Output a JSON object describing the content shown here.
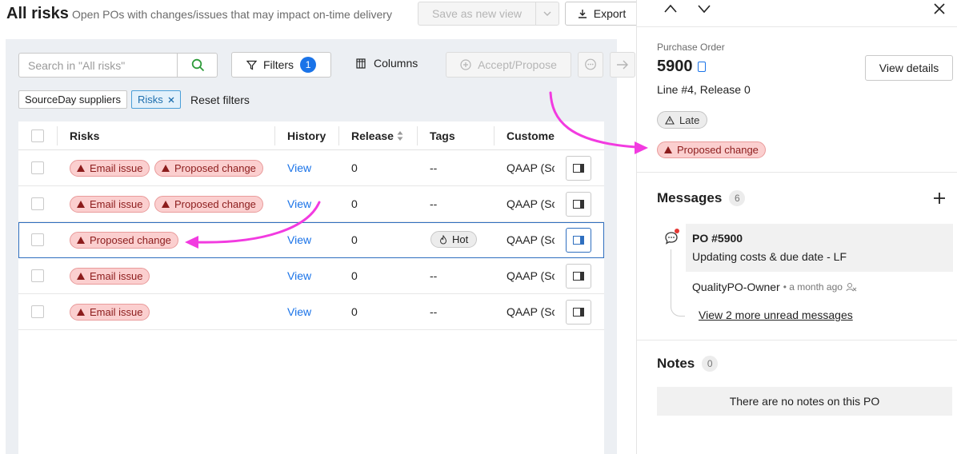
{
  "header": {
    "title": "All risks",
    "subtitle": "Open POs with changes/issues that may impact on-time delivery",
    "save_view_label": "Save as new view",
    "export_label": "Export"
  },
  "toolbar": {
    "search_placeholder": "Search in \"All risks\"",
    "filters_label": "Filters",
    "filters_count": "1",
    "columns_label": "Columns",
    "accept_label": "Accept/Propose"
  },
  "filter_chips": {
    "suppliers": "SourceDay suppliers",
    "risks": "Risks",
    "reset": "Reset filters"
  },
  "table": {
    "headers": [
      "Risks",
      "History",
      "Release",
      "Tags",
      "Custome"
    ],
    "rows": [
      {
        "risks": [
          "Email issue",
          "Proposed change"
        ],
        "history": "View",
        "release": "0",
        "tags": "--",
        "customer": "QAAP (Sc",
        "selected": false
      },
      {
        "risks": [
          "Email issue",
          "Proposed change"
        ],
        "history": "View",
        "release": "0",
        "tags": "--",
        "customer": "QAAP (Sc",
        "selected": false
      },
      {
        "risks": [
          "Proposed change"
        ],
        "history": "View",
        "release": "0",
        "tags": "Hot",
        "customer": "QAAP (Sc",
        "selected": true
      },
      {
        "risks": [
          "Email issue"
        ],
        "history": "View",
        "release": "0",
        "tags": "--",
        "customer": "QAAP (Sc",
        "selected": false
      },
      {
        "risks": [
          "Email issue"
        ],
        "history": "View",
        "release": "0",
        "tags": "--",
        "customer": "QAAP (Sc",
        "selected": false
      }
    ]
  },
  "detail": {
    "po_label": "Purchase Order",
    "po_number": "5900",
    "line_info": "Line #4, Release 0",
    "view_details_label": "View details",
    "late_label": "Late",
    "proposed_label": "Proposed change",
    "messages": {
      "title": "Messages",
      "count": "6",
      "thread_title": "PO #5900",
      "thread_text": "Updating costs & due date - LF",
      "author": "QualityPO-Owner",
      "time": "• a month ago",
      "more_unread": "View 2 more unread messages"
    },
    "notes": {
      "title": "Notes",
      "count": "0",
      "empty_text": "There are no notes on this PO"
    }
  },
  "colors": {
    "accent": "#1a73e8",
    "risk_badge_bg": "#fbcfcf",
    "risk_badge_text": "#8c1c1c",
    "annotation_arrow": "#f23be0"
  }
}
